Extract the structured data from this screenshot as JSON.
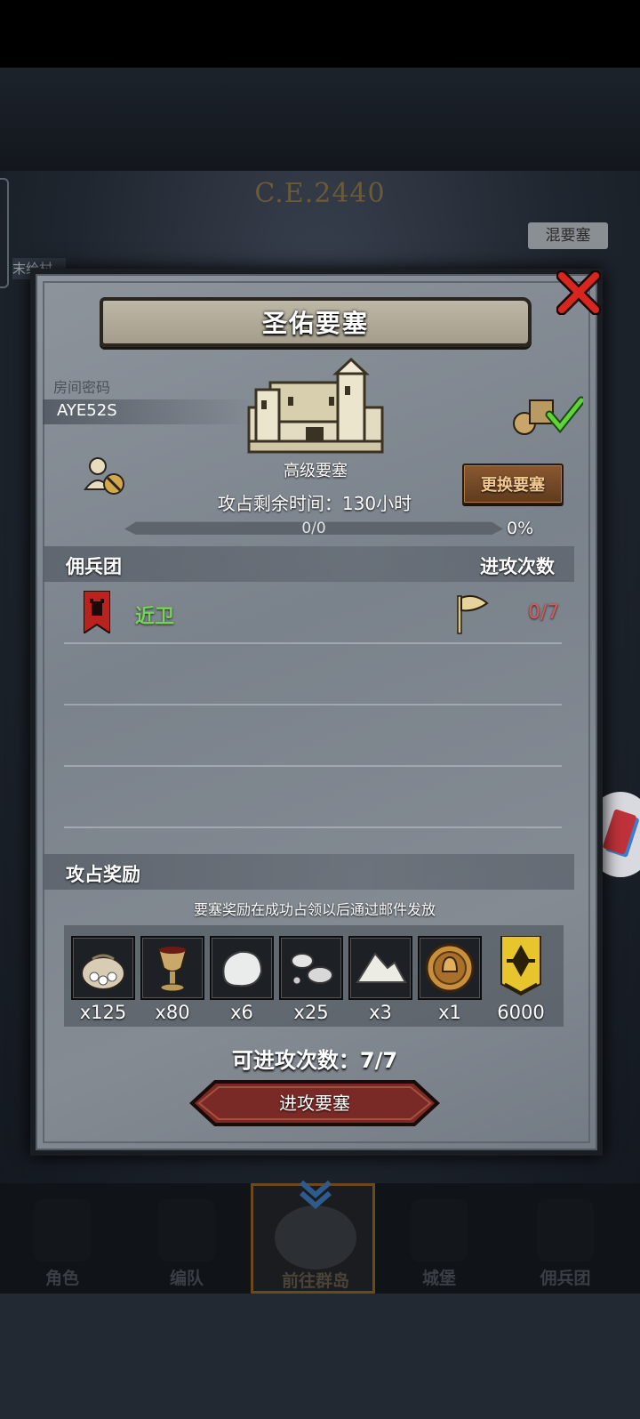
{
  "background": {
    "era_year": "C.E.2440",
    "map_tag": "混要塞",
    "village_tag": "末给村"
  },
  "dialog": {
    "title": "圣佑要塞",
    "room_code_label": "房间密码",
    "room_code": "AYE52S",
    "fortress_level": "高级要塞",
    "change_button": "更换要塞",
    "time_remaining": "攻占剩余时间：130小时",
    "progress": {
      "text": "0/0",
      "percent_text": "0%",
      "value": 0
    },
    "mercenaries": {
      "header": "佣兵团",
      "attacks_header": "进攻次数",
      "rows": [
        {
          "name": "近卫",
          "attacks": "0/7",
          "banner_color": "#b8231f"
        }
      ]
    },
    "rewards": {
      "header": "攻占奖励",
      "note": "要塞奖励在成功占领以后通过邮件发放",
      "items": [
        {
          "icon": "coin-sack-icon",
          "qty": "x125"
        },
        {
          "icon": "goblet-icon",
          "qty": "x80"
        },
        {
          "icon": "white-stone-icon",
          "qty": "x6"
        },
        {
          "icon": "silver-ore-icon",
          "qty": "x25"
        },
        {
          "icon": "salt-pile-icon",
          "qty": "x3"
        },
        {
          "icon": "knight-medal-icon",
          "qty": "x1"
        },
        {
          "icon": "guild-emblem-icon",
          "qty": "6000"
        }
      ]
    },
    "attack_count": "可进攻次数：7/7",
    "attack_button": "进攻要塞"
  },
  "nav": [
    {
      "label": "角色",
      "icon": "knight-icon"
    },
    {
      "label": "编队",
      "icon": "helmet-icon"
    },
    {
      "label": "前往群岛",
      "icon": "globe-icon",
      "active": true
    },
    {
      "label": "城堡",
      "icon": "castle-icon"
    },
    {
      "label": "佣兵团",
      "icon": "ship-icon"
    }
  ],
  "colors": {
    "accent_gold": "#d3b45e",
    "merc_name": "#78d05e",
    "attacks_red": "#d65a5a",
    "button_red": "#7a2a26"
  }
}
